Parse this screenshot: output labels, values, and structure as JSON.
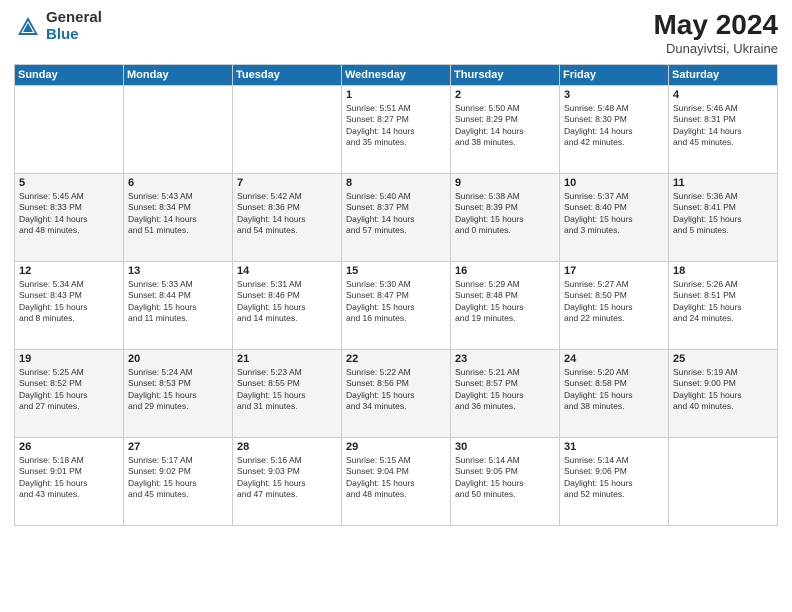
{
  "header": {
    "logo_general": "General",
    "logo_blue": "Blue",
    "month_year": "May 2024",
    "location": "Dunayivtsi, Ukraine"
  },
  "days_of_week": [
    "Sunday",
    "Monday",
    "Tuesday",
    "Wednesday",
    "Thursday",
    "Friday",
    "Saturday"
  ],
  "weeks": [
    [
      {
        "day": "",
        "info": ""
      },
      {
        "day": "",
        "info": ""
      },
      {
        "day": "",
        "info": ""
      },
      {
        "day": "1",
        "info": "Sunrise: 5:51 AM\nSunset: 8:27 PM\nDaylight: 14 hours\nand 35 minutes."
      },
      {
        "day": "2",
        "info": "Sunrise: 5:50 AM\nSunset: 8:29 PM\nDaylight: 14 hours\nand 38 minutes."
      },
      {
        "day": "3",
        "info": "Sunrise: 5:48 AM\nSunset: 8:30 PM\nDaylight: 14 hours\nand 42 minutes."
      },
      {
        "day": "4",
        "info": "Sunrise: 5:46 AM\nSunset: 8:31 PM\nDaylight: 14 hours\nand 45 minutes."
      }
    ],
    [
      {
        "day": "5",
        "info": "Sunrise: 5:45 AM\nSunset: 8:33 PM\nDaylight: 14 hours\nand 48 minutes."
      },
      {
        "day": "6",
        "info": "Sunrise: 5:43 AM\nSunset: 8:34 PM\nDaylight: 14 hours\nand 51 minutes."
      },
      {
        "day": "7",
        "info": "Sunrise: 5:42 AM\nSunset: 8:36 PM\nDaylight: 14 hours\nand 54 minutes."
      },
      {
        "day": "8",
        "info": "Sunrise: 5:40 AM\nSunset: 8:37 PM\nDaylight: 14 hours\nand 57 minutes."
      },
      {
        "day": "9",
        "info": "Sunrise: 5:38 AM\nSunset: 8:39 PM\nDaylight: 15 hours\nand 0 minutes."
      },
      {
        "day": "10",
        "info": "Sunrise: 5:37 AM\nSunset: 8:40 PM\nDaylight: 15 hours\nand 3 minutes."
      },
      {
        "day": "11",
        "info": "Sunrise: 5:36 AM\nSunset: 8:41 PM\nDaylight: 15 hours\nand 5 minutes."
      }
    ],
    [
      {
        "day": "12",
        "info": "Sunrise: 5:34 AM\nSunset: 8:43 PM\nDaylight: 15 hours\nand 8 minutes."
      },
      {
        "day": "13",
        "info": "Sunrise: 5:33 AM\nSunset: 8:44 PM\nDaylight: 15 hours\nand 11 minutes."
      },
      {
        "day": "14",
        "info": "Sunrise: 5:31 AM\nSunset: 8:46 PM\nDaylight: 15 hours\nand 14 minutes."
      },
      {
        "day": "15",
        "info": "Sunrise: 5:30 AM\nSunset: 8:47 PM\nDaylight: 15 hours\nand 16 minutes."
      },
      {
        "day": "16",
        "info": "Sunrise: 5:29 AM\nSunset: 8:48 PM\nDaylight: 15 hours\nand 19 minutes."
      },
      {
        "day": "17",
        "info": "Sunrise: 5:27 AM\nSunset: 8:50 PM\nDaylight: 15 hours\nand 22 minutes."
      },
      {
        "day": "18",
        "info": "Sunrise: 5:26 AM\nSunset: 8:51 PM\nDaylight: 15 hours\nand 24 minutes."
      }
    ],
    [
      {
        "day": "19",
        "info": "Sunrise: 5:25 AM\nSunset: 8:52 PM\nDaylight: 15 hours\nand 27 minutes."
      },
      {
        "day": "20",
        "info": "Sunrise: 5:24 AM\nSunset: 8:53 PM\nDaylight: 15 hours\nand 29 minutes."
      },
      {
        "day": "21",
        "info": "Sunrise: 5:23 AM\nSunset: 8:55 PM\nDaylight: 15 hours\nand 31 minutes."
      },
      {
        "day": "22",
        "info": "Sunrise: 5:22 AM\nSunset: 8:56 PM\nDaylight: 15 hours\nand 34 minutes."
      },
      {
        "day": "23",
        "info": "Sunrise: 5:21 AM\nSunset: 8:57 PM\nDaylight: 15 hours\nand 36 minutes."
      },
      {
        "day": "24",
        "info": "Sunrise: 5:20 AM\nSunset: 8:58 PM\nDaylight: 15 hours\nand 38 minutes."
      },
      {
        "day": "25",
        "info": "Sunrise: 5:19 AM\nSunset: 9:00 PM\nDaylight: 15 hours\nand 40 minutes."
      }
    ],
    [
      {
        "day": "26",
        "info": "Sunrise: 5:18 AM\nSunset: 9:01 PM\nDaylight: 15 hours\nand 43 minutes."
      },
      {
        "day": "27",
        "info": "Sunrise: 5:17 AM\nSunset: 9:02 PM\nDaylight: 15 hours\nand 45 minutes."
      },
      {
        "day": "28",
        "info": "Sunrise: 5:16 AM\nSunset: 9:03 PM\nDaylight: 15 hours\nand 47 minutes."
      },
      {
        "day": "29",
        "info": "Sunrise: 5:15 AM\nSunset: 9:04 PM\nDaylight: 15 hours\nand 48 minutes."
      },
      {
        "day": "30",
        "info": "Sunrise: 5:14 AM\nSunset: 9:05 PM\nDaylight: 15 hours\nand 50 minutes."
      },
      {
        "day": "31",
        "info": "Sunrise: 5:14 AM\nSunset: 9:06 PM\nDaylight: 15 hours\nand 52 minutes."
      },
      {
        "day": "",
        "info": ""
      }
    ]
  ]
}
